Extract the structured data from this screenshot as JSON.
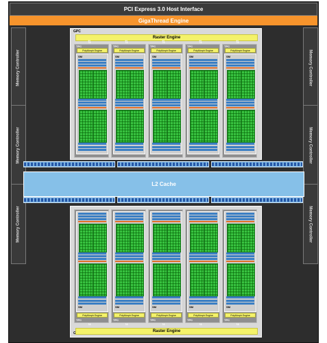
{
  "pcie_label": "PCI Express 3.0 Host Interface",
  "gigathread_label": "GigaThread Engine",
  "memory_controller_label": "Memory Controller",
  "l2_label": "L2 Cache",
  "gpc": {
    "label": "GPC",
    "raster_label": "Raster Engine"
  },
  "tpc": {
    "label": "TPC",
    "polymorph_label": "PolyMorph Engine"
  },
  "sm": {
    "label": "SM"
  },
  "counts": {
    "gpcs": 2,
    "tpcs_per_gpc": 5,
    "sms_per_tpc": 1,
    "memory_controllers": 6
  },
  "colors": {
    "chip_bg": "#2d2d2d",
    "gigathread": "#f7942c",
    "raster": "#f4f26a",
    "cuda_core": "#38c240",
    "l2": "#86c0e8",
    "blue": "#3b7fc4",
    "orange": "#e0702b"
  }
}
